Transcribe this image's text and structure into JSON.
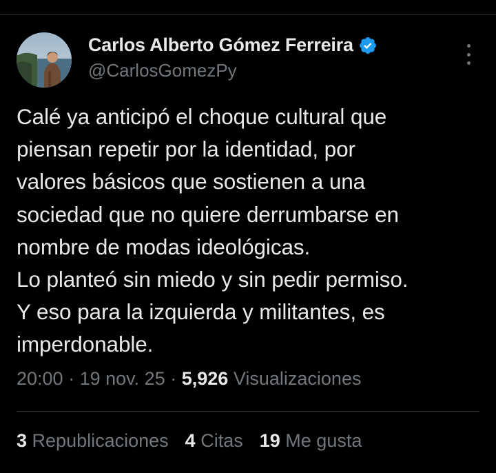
{
  "author": {
    "display_name": "Carlos Alberto Gómez Ferreira",
    "handle": "@CarlosGomezPy",
    "verified": true,
    "avatar": "profile-photo-man-by-sea-cliff"
  },
  "tweet": {
    "lines": [
      "Calé ya anticipó el choque cultural que",
      "piensan repetir por la identidad, por",
      "valores básicos que sostienen a una",
      "sociedad que no quiere derrumbarse en",
      "nombre de modas ideológicas.",
      "Lo planteó sin miedo y sin pedir permiso.",
      "Y eso para la izquierda y militantes, es",
      "imperdonable."
    ]
  },
  "meta": {
    "time": "20:00",
    "separator": "·",
    "date": "19 nov. 25",
    "views_count": "5,926",
    "views_label": "Visualizaciones"
  },
  "stats": {
    "reposts_count": "3",
    "reposts_label": "Republicaciones",
    "quotes_count": "4",
    "quotes_label": "Citas",
    "likes_count": "19",
    "likes_label": "Me gusta"
  },
  "icons": {
    "verified": "verified-badge-icon",
    "more": "more-options-icon"
  },
  "colors": {
    "background": "#000000",
    "text_primary": "#e7e9ea",
    "text_secondary": "#71767b",
    "verified_blue": "#1d9bf0",
    "divider": "#2f3336"
  }
}
